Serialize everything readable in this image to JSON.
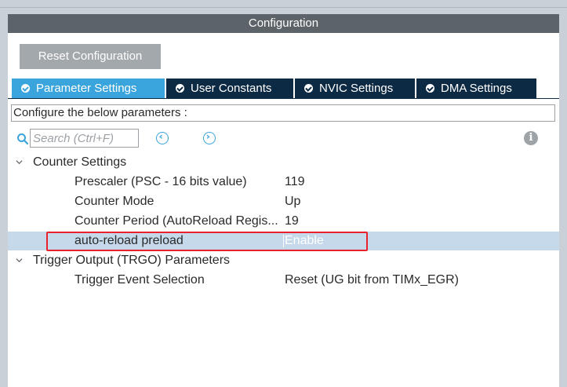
{
  "panel": {
    "title": "Configuration",
    "reset_label": "Reset Configuration"
  },
  "tabs": [
    {
      "label": "Parameter Settings",
      "active": true
    },
    {
      "label": "User Constants",
      "active": false
    },
    {
      "label": "NVIC Settings",
      "active": false
    },
    {
      "label": "DMA Settings",
      "active": false
    }
  ],
  "description": "Configure the below parameters :",
  "search": {
    "placeholder": "Search (Ctrl+F)",
    "value": ""
  },
  "groups": [
    {
      "label": "Counter Settings",
      "params": [
        {
          "label": "Prescaler (PSC - 16 bits value)",
          "value": "119"
        },
        {
          "label": "Counter Mode",
          "value": "Up"
        },
        {
          "label": "Counter Period (AutoReload Regis...",
          "value": "19"
        },
        {
          "label": "auto-reload preload",
          "value": "Enable",
          "selected": true
        }
      ]
    },
    {
      "label": "Trigger Output (TRGO) Parameters",
      "params": [
        {
          "label": "Trigger Event Selection",
          "value": "Reset (UG bit from TIMx_EGR)"
        }
      ]
    }
  ],
  "colors": {
    "header_bg": "#5c6369",
    "tab_active": "#3aa4dc",
    "tab_inactive": "#0d2a44",
    "selected_row": "#c6d9ea",
    "highlight_border": "#e8212a"
  }
}
